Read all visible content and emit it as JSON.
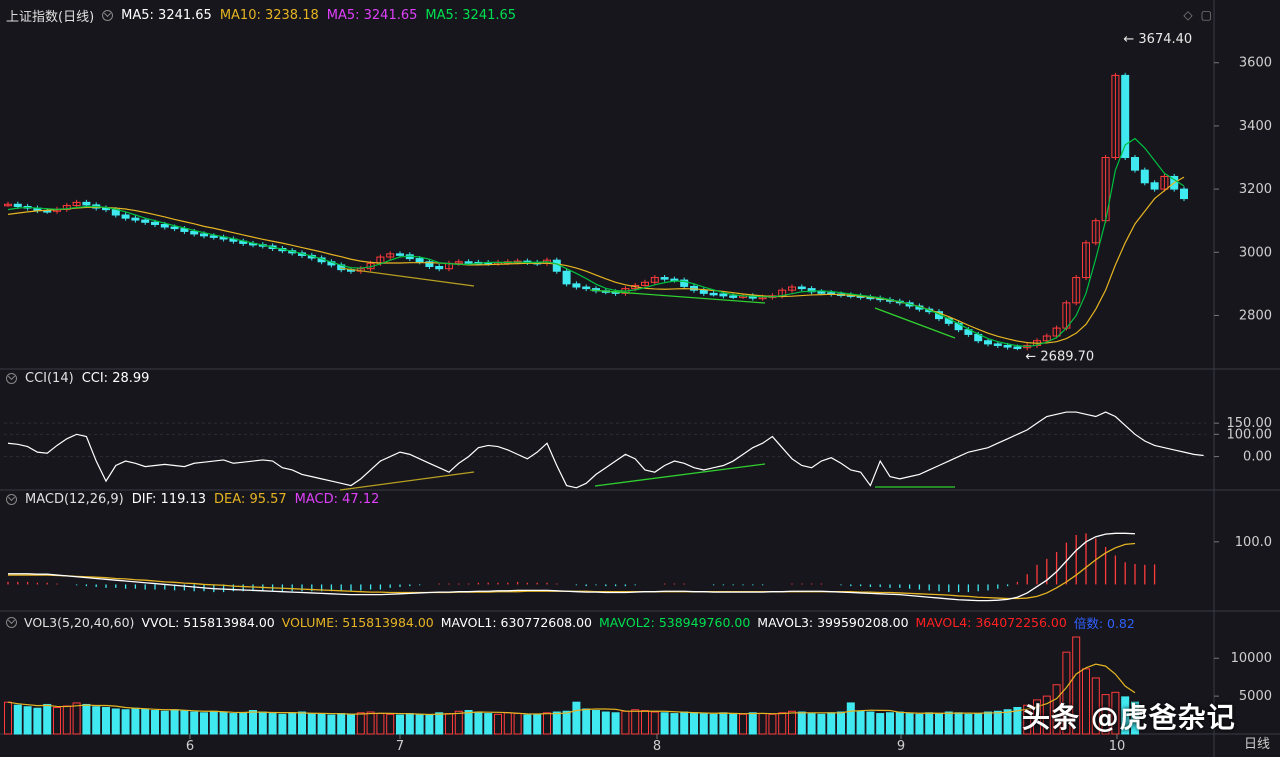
{
  "headers": {
    "main": {
      "name": "上证指数(日线)",
      "items": [
        {
          "text": "MA5: 3241.65",
          "color": "#ffffff"
        },
        {
          "text": "MA10: 3238.18",
          "color": "#e6b422"
        },
        {
          "text": "MA5: 3241.65",
          "color": "#e040fb"
        },
        {
          "text": "MA5: 3241.65",
          "color": "#00e050"
        }
      ]
    },
    "cci": {
      "name": "CCI(14)",
      "items": [
        {
          "text": "CCI: 28.99",
          "color": "#ffffff"
        }
      ]
    },
    "macd": {
      "name": "MACD(12,26,9)",
      "items": [
        {
          "text": "DIF: 119.13",
          "color": "#ffffff"
        },
        {
          "text": "DEA: 95.57",
          "color": "#e6b422"
        },
        {
          "text": "MACD: 47.12",
          "color": "#e040fb"
        }
      ]
    },
    "vol": {
      "name": "VOL3(5,20,40,60)",
      "items": [
        {
          "text": "VVOL: 515813984.00",
          "color": "#ffffff"
        },
        {
          "text": "VOLUME: 515813984.00",
          "color": "#e6b422"
        },
        {
          "text": "MAVOL1: 630772608.00",
          "color": "#ffffff"
        },
        {
          "text": "MAVOL2: 538949760.00",
          "color": "#00e050"
        },
        {
          "text": "MAVOL3: 399590208.00",
          "color": "#ffffff"
        },
        {
          "text": "MAVOL4: 364072256.00",
          "color": "#ff2020"
        },
        {
          "text": "倍数: 0.82",
          "color": "#3060ff"
        }
      ]
    }
  },
  "chart_data": [
    {
      "type": "candlestick",
      "title": "上证指数(日线)",
      "ylim": [
        2640,
        3710
      ],
      "yticks": [
        2800,
        3000,
        3200,
        3400,
        3600
      ],
      "annotations": [
        {
          "label": "3674.40",
          "value": 3674.4
        },
        {
          "label": "2689.70",
          "value": 2689.7
        }
      ],
      "close": [
        3152,
        3145,
        3140,
        3132,
        3130,
        3136,
        3148,
        3158,
        3150,
        3140,
        3135,
        3118,
        3108,
        3102,
        3095,
        3088,
        3080,
        3075,
        3066,
        3058,
        3052,
        3048,
        3042,
        3035,
        3028,
        3024,
        3020,
        3012,
        3005,
        2998,
        2990,
        2982,
        2970,
        2960,
        2945,
        2940,
        2948,
        2965,
        2985,
        2995,
        2992,
        2980,
        2970,
        2955,
        2948,
        2965,
        2970,
        2968,
        2967,
        2965,
        2968,
        2970,
        2972,
        2968,
        2965,
        2975,
        2940,
        2900,
        2890,
        2885,
        2878,
        2875,
        2870,
        2885,
        2895,
        2905,
        2920,
        2915,
        2912,
        2892,
        2880,
        2870,
        2868,
        2862,
        2860,
        2862,
        2855,
        2858,
        2862,
        2880,
        2890,
        2885,
        2875,
        2872,
        2868,
        2865,
        2862,
        2858,
        2855,
        2850,
        2845,
        2840,
        2830,
        2820,
        2812,
        2790,
        2775,
        2755,
        2740,
        2720,
        2710,
        2705,
        2700,
        2698,
        2705,
        2720,
        2735,
        2760,
        2840,
        2920,
        3030,
        3100,
        3300,
        3560,
        3300,
        3260,
        3220,
        3200,
        3240,
        3200,
        3170
      ],
      "ma5": [
        3135,
        3140,
        3142,
        3140,
        3138,
        3136,
        3138,
        3142,
        3145,
        3145,
        3142,
        3136,
        3128,
        3118,
        3108,
        3100,
        3092,
        3084,
        3077,
        3069,
        3062,
        3055,
        3049,
        3043,
        3036,
        3029,
        3023,
        3016,
        3010,
        3003,
        2996,
        2988,
        2979,
        2969,
        2959,
        2951,
        2950,
        2954,
        2963,
        2975,
        2985,
        2988,
        2985,
        2978,
        2967,
        2964,
        2962,
        2962,
        2965,
        2968,
        2968,
        2968,
        2969,
        2968,
        2968,
        2970,
        2963,
        2948,
        2933,
        2917,
        2899,
        2886,
        2879,
        2877,
        2881,
        2888,
        2897,
        2904,
        2909,
        2908,
        2900,
        2890,
        2881,
        2872,
        2866,
        2862,
        2861,
        2859,
        2859,
        2863,
        2869,
        2875,
        2877,
        2878,
        2876,
        2872,
        2868,
        2864,
        2860,
        2856,
        2850,
        2844,
        2836,
        2827,
        2817,
        2804,
        2789,
        2774,
        2757,
        2741,
        2727,
        2717,
        2710,
        2704,
        2702,
        2706,
        2716,
        2730,
        2760,
        2800,
        2870,
        2980,
        3100,
        3260,
        3340,
        3360,
        3330,
        3290,
        3250,
        3230,
        3210
      ],
      "ma10": [
        3120,
        3124,
        3128,
        3131,
        3133,
        3135,
        3137,
        3140,
        3142,
        3143,
        3142,
        3140,
        3137,
        3132,
        3126,
        3119,
        3112,
        3104,
        3097,
        3090,
        3082,
        3076,
        3069,
        3062,
        3055,
        3048,
        3041,
        3035,
        3029,
        3022,
        3015,
        3008,
        3001,
        2993,
        2986,
        2978,
        2972,
        2968,
        2966,
        2966,
        2966,
        2967,
        2967,
        2967,
        2966,
        2964,
        2962,
        2960,
        2960,
        2961,
        2962,
        2963,
        2964,
        2965,
        2965,
        2965,
        2963,
        2958,
        2950,
        2940,
        2928,
        2916,
        2905,
        2897,
        2891,
        2886,
        2884,
        2883,
        2884,
        2885,
        2884,
        2882,
        2879,
        2876,
        2872,
        2868,
        2865,
        2862,
        2860,
        2860,
        2861,
        2863,
        2865,
        2866,
        2867,
        2866,
        2864,
        2861,
        2858,
        2854,
        2849,
        2843,
        2836,
        2828,
        2818,
        2808,
        2796,
        2783,
        2769,
        2756,
        2744,
        2734,
        2726,
        2719,
        2714,
        2712,
        2713,
        2717,
        2727,
        2744,
        2772,
        2820,
        2880,
        2960,
        3030,
        3090,
        3130,
        3170,
        3195,
        3220,
        3238
      ],
      "grid": false
    },
    {
      "type": "line",
      "title": "CCI(14)",
      "ylim": [
        -150,
        290
      ],
      "yticks": [
        0.0,
        100.0,
        150.0
      ],
      "series": [
        {
          "name": "CCI",
          "values": [
            60,
            55,
            45,
            20,
            15,
            50,
            80,
            100,
            90,
            -20,
            -110,
            -40,
            -20,
            -30,
            -45,
            -40,
            -35,
            -40,
            -45,
            -30,
            -25,
            -20,
            -15,
            -30,
            -25,
            -20,
            -15,
            -20,
            -50,
            -60,
            -80,
            -90,
            -100,
            -110,
            -120,
            -130,
            -100,
            -60,
            -20,
            0,
            20,
            10,
            -10,
            -30,
            -50,
            -70,
            -30,
            0,
            40,
            50,
            45,
            30,
            10,
            -10,
            20,
            60,
            -40,
            -130,
            -140,
            -120,
            -80,
            -50,
            -20,
            10,
            -10,
            -60,
            -70,
            -40,
            -20,
            -30,
            -50,
            -60,
            -50,
            -40,
            -20,
            10,
            40,
            60,
            90,
            40,
            -10,
            -40,
            -50,
            -20,
            -5,
            -30,
            -60,
            -70,
            -130,
            -20,
            -90,
            -100,
            -90,
            -80,
            -60,
            -40,
            -20,
            0,
            20,
            30,
            40,
            60,
            80,
            100,
            120,
            150,
            180,
            190,
            200,
            200,
            190,
            180,
            200,
            180,
            140,
            100,
            70,
            50,
            40,
            30,
            20,
            10,
            5
          ],
          "color": "#ffffff"
        }
      ]
    },
    {
      "type": "bar",
      "title": "MACD(12,26,9)",
      "ylim": [
        -60,
        170
      ],
      "yticks": [
        100.0
      ],
      "series": [
        {
          "name": "DIF",
          "color": "#ffffff",
          "values": [
            25,
            25,
            25,
            24,
            24,
            22,
            20,
            18,
            16,
            14,
            12,
            10,
            8,
            6,
            4,
            2,
            0,
            -2,
            -4,
            -6,
            -8,
            -10,
            -11,
            -12,
            -13,
            -14,
            -15,
            -16,
            -17,
            -18,
            -19,
            -20,
            -21,
            -22,
            -23,
            -24,
            -24,
            -24,
            -24,
            -23,
            -22,
            -21,
            -20,
            -19,
            -18,
            -18,
            -17,
            -17,
            -16,
            -16,
            -15,
            -15,
            -14,
            -14,
            -14,
            -14,
            -15,
            -16,
            -17,
            -18,
            -18,
            -19,
            -19,
            -19,
            -18,
            -17,
            -17,
            -16,
            -16,
            -16,
            -17,
            -17,
            -18,
            -18,
            -18,
            -18,
            -18,
            -18,
            -17,
            -17,
            -16,
            -16,
            -16,
            -16,
            -17,
            -18,
            -19,
            -20,
            -21,
            -22,
            -23,
            -24,
            -26,
            -28,
            -30,
            -32,
            -34,
            -36,
            -37,
            -38,
            -38,
            -37,
            -35,
            -30,
            -20,
            -5,
            10,
            30,
            55,
            80,
            100,
            112,
            118,
            120,
            120,
            119
          ],
          "data": "dif"
        },
        {
          "name": "DEA",
          "color": "#e6b422",
          "values": [
            22,
            22,
            22,
            22,
            22,
            21,
            20,
            19,
            18,
            17,
            16,
            14,
            13,
            11,
            10,
            8,
            6,
            5,
            3,
            2,
            0,
            -1,
            -2,
            -4,
            -5,
            -6,
            -7,
            -8,
            -9,
            -10,
            -11,
            -12,
            -13,
            -14,
            -15,
            -16,
            -17,
            -18,
            -18,
            -19,
            -19,
            -19,
            -19,
            -19,
            -19,
            -19,
            -18,
            -18,
            -18,
            -18,
            -17,
            -17,
            -17,
            -16,
            -16,
            -16,
            -16,
            -16,
            -16,
            -16,
            -17,
            -17,
            -17,
            -17,
            -17,
            -17,
            -17,
            -17,
            -17,
            -17,
            -17,
            -17,
            -17,
            -17,
            -17,
            -17,
            -17,
            -17,
            -17,
            -17,
            -17,
            -17,
            -17,
            -17,
            -17,
            -17,
            -17,
            -18,
            -18,
            -19,
            -19,
            -20,
            -21,
            -22,
            -23,
            -24,
            -25,
            -27,
            -28,
            -30,
            -31,
            -32,
            -33,
            -33,
            -32,
            -28,
            -20,
            -8,
            6,
            22,
            40,
            58,
            74,
            86,
            94,
            96
          ]
        },
        {
          "name": "MACD",
          "color": "#e040fb",
          "values": [
            6,
            6,
            6,
            4,
            4,
            2,
            0,
            -2,
            -4,
            -6,
            -8,
            -8,
            -10,
            -10,
            -12,
            -12,
            -12,
            -14,
            -14,
            -16,
            -16,
            -18,
            -18,
            -16,
            -16,
            -16,
            -16,
            -16,
            -16,
            -16,
            -16,
            -16,
            -16,
            -16,
            -16,
            -16,
            -14,
            -12,
            -12,
            -8,
            -6,
            -4,
            -2,
            0,
            2,
            2,
            2,
            2,
            4,
            4,
            4,
            4,
            6,
            4,
            4,
            4,
            2,
            0,
            -2,
            -4,
            -2,
            -4,
            -4,
            -4,
            -2,
            0,
            0,
            2,
            2,
            2,
            0,
            0,
            -2,
            -2,
            -2,
            -2,
            -2,
            -2,
            0,
            0,
            2,
            2,
            2,
            2,
            0,
            -2,
            -4,
            -4,
            -6,
            -6,
            -8,
            -8,
            -10,
            -12,
            -14,
            -16,
            -18,
            -18,
            -18,
            -16,
            -14,
            -10,
            -4,
            6,
            24,
            46,
            60,
            76,
            98,
            116,
            120,
            108,
            88,
            68,
            52,
            48,
            46,
            47
          ]
        }
      ]
    },
    {
      "type": "bar",
      "title": "VOL3(5,20,40,60)",
      "ylim": [
        0,
        13200
      ],
      "yticks": [
        5000,
        10000
      ],
      "series": [
        {
          "name": "VOLUME",
          "values": [
            4200,
            3800,
            3600,
            3400,
            3900,
            3500,
            3700,
            4100,
            3900,
            3600,
            3500,
            3300,
            3200,
            3400,
            3300,
            3100,
            3000,
            3200,
            3100,
            2900,
            2800,
            3000,
            2900,
            2700,
            2800,
            3100,
            2900,
            2700,
            2600,
            2800,
            2900,
            2700,
            2600,
            2500,
            2700,
            2600,
            2800,
            2900,
            2700,
            2600,
            2500,
            2700,
            2600,
            2500,
            2800,
            2700,
            3000,
            3100,
            2900,
            2700,
            2600,
            2800,
            2700,
            2500,
            2600,
            2800,
            2900,
            3000,
            4200,
            3300,
            3100,
            2900,
            2800,
            3000,
            3200,
            3100,
            2900,
            2800,
            2700,
            2900,
            2800,
            2700,
            2600,
            2800,
            2700,
            2600,
            2800,
            2700,
            2600,
            2800,
            3000,
            2900,
            2700,
            2600,
            2800,
            2900,
            4100,
            3000,
            2900,
            2700,
            2800,
            2900,
            2700,
            2600,
            2800,
            2700,
            2900,
            2800,
            2600,
            2700,
            2900,
            3000,
            3200,
            3500,
            3800,
            4500,
            5000,
            6500,
            10800,
            12800,
            8600,
            7400,
            5200,
            5500,
            4900,
            4200
          ]
        }
      ],
      "color": "#40e8f0"
    }
  ],
  "x_axis": {
    "labels": [
      "6",
      "7",
      "8",
      "9",
      "10"
    ],
    "period": "日线"
  },
  "watermark": "头条 @虎爸杂记"
}
